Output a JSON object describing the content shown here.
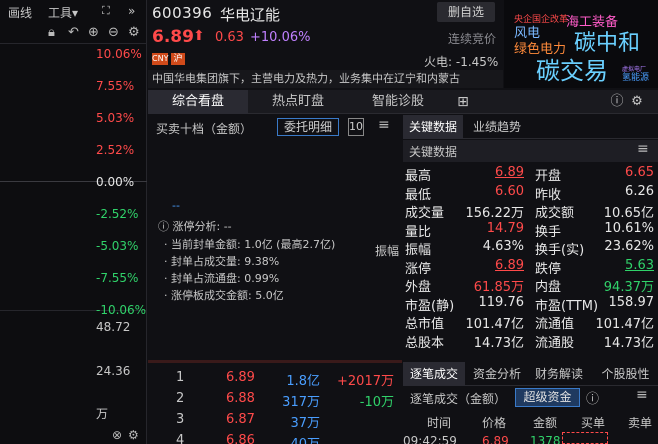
{
  "left_panel": {
    "toolbar": {
      "draw_line": "画线",
      "tools": "工具▾",
      "expand": "»"
    },
    "axis_labels": [
      {
        "text": "10.06%",
        "color": "#ff4a4a"
      },
      {
        "text": "7.55%",
        "color": "#ff4a4a"
      },
      {
        "text": "5.03%",
        "color": "#ff4a4a"
      },
      {
        "text": "2.52%",
        "color": "#ff4a4a"
      },
      {
        "text": "0.00%",
        "color": "#e8e8e8"
      },
      {
        "text": "-2.52%",
        "color": "#30d26a"
      },
      {
        "text": "-5.03%",
        "color": "#30d26a"
      },
      {
        "text": "-7.55%",
        "color": "#30d26a"
      },
      {
        "text": "-10.06%",
        "color": "#30d26a"
      }
    ],
    "volume_labels": [
      "48.72",
      "24.36",
      "万"
    ]
  },
  "header": {
    "code": "600396",
    "name": "华电辽能",
    "fav_button": "删自选",
    "price": "6.89",
    "arrow": "⬆",
    "change": "0.63",
    "change_pct": "+10.06%",
    "status": "连续竞价",
    "badge_cny": "CNY",
    "badge_market": "沪",
    "sector": "火电: -1.45%",
    "description": "中国华电集团旗下，主营电力及热力，业务集中在辽宁和内蒙古"
  },
  "word_cloud": [
    {
      "text": "央企国企改革",
      "color": "#ff4a4a"
    },
    {
      "text": "海工装备",
      "color": "#ff5cc8"
    },
    {
      "text": "风电",
      "color": "#7ab8ff"
    },
    {
      "text": "碳中和",
      "color": "#6ad0ff"
    },
    {
      "text": "绿色电力",
      "color": "#ff8a3a"
    },
    {
      "text": "碳交易",
      "color": "#6ad0ff"
    },
    {
      "text": "虚拟电厂",
      "color": "#b080ff"
    },
    {
      "text": "氢能源",
      "color": "#4a9eff"
    }
  ],
  "tabs": [
    "综合看盘",
    "热点盯盘",
    "智能诊股"
  ],
  "order_panel": {
    "title": "买卖十档（金额）",
    "entrust_button": "委托明细",
    "num_button": "10",
    "dash": "--",
    "analysis_title": "涨停分析:  --",
    "lines": [
      "· 当前封单金额: 1.0亿 (最高2.7亿)",
      "· 封单占成交量: 9.38%",
      "· 封单占流通盘: 0.99%",
      "· 涨停板成交金额: 5.0亿"
    ],
    "side_label": "振幅"
  },
  "key_data": {
    "tab_key": "关键数据",
    "tab_trend": "业绩趋势",
    "sub_title": "关键数据",
    "rows": [
      {
        "l1": "最高",
        "v1": "6.89",
        "c1": "#ff4a4a",
        "u1": true,
        "l2": "开盘",
        "v2": "6.65",
        "c2": "#ff4a4a"
      },
      {
        "l1": "最低",
        "v1": "6.60",
        "c1": "#ff4a4a",
        "l2": "昨收",
        "v2": "6.26",
        "c2": "#e8e8e8"
      },
      {
        "l1": "成交量",
        "v1": "156.22万",
        "c1": "#e8e8e8",
        "l2": "成交额",
        "v2": "10.65亿",
        "c2": "#e8e8e8"
      },
      {
        "l1": "量比",
        "v1": "14.79",
        "c1": "#ff4a4a",
        "l2": "换手",
        "v2": "10.61%",
        "c2": "#e8e8e8"
      },
      {
        "l1": "振幅",
        "v1": "4.63%",
        "c1": "#e8e8e8",
        "l2": "换手(实)",
        "v2": "23.62%",
        "c2": "#e8e8e8"
      },
      {
        "l1": "涨停",
        "v1": "6.89",
        "c1": "#ff4a4a",
        "u1": true,
        "l2": "跌停",
        "v2": "5.63",
        "c2": "#30d26a",
        "u2": true
      },
      {
        "l1": "外盘",
        "v1": "61.85万",
        "c1": "#ff4a4a",
        "l2": "内盘",
        "v2": "94.37万",
        "c2": "#30d26a"
      },
      {
        "l1": "市盈(静)",
        "v1": "119.76",
        "c1": "#e8e8e8",
        "l2": "市盈(TTM)",
        "v2": "158.97",
        "c2": "#e8e8e8"
      },
      {
        "l1": "总市值",
        "v1": "101.47亿",
        "c1": "#e8e8e8",
        "l2": "流通值",
        "v2": "101.47亿",
        "c2": "#e8e8e8"
      },
      {
        "l1": "总股本",
        "v1": "14.73亿",
        "c1": "#e8e8e8",
        "l2": "流通股",
        "v2": "14.73亿",
        "c2": "#e8e8e8"
      }
    ]
  },
  "top_buyers": [
    {
      "rank": "1",
      "price": "6.89",
      "amount": "1.8亿",
      "delta": "+2017万",
      "dcolor": "#ff4a4a"
    },
    {
      "rank": "2",
      "price": "6.88",
      "amount": "317万",
      "delta": "-10万",
      "dcolor": "#30d26a"
    },
    {
      "rank": "3",
      "price": "6.87",
      "amount": "37万",
      "delta": "",
      "dcolor": "#e8e8e8"
    },
    {
      "rank": "4",
      "price": "6.86",
      "amount": "40万",
      "delta": "",
      "dcolor": "#e8e8e8"
    }
  ],
  "trade_panel": {
    "tabs": [
      "逐笔成交",
      "资金分析",
      "财务解读",
      "个股股性"
    ],
    "title": "逐笔成交（金额）",
    "superfund_button": "超级资金",
    "headers": [
      "时间",
      "价格",
      "金额",
      "买单",
      "卖单"
    ],
    "partial_row": {
      "time": "09:42:59",
      "price": "6.89",
      "amount": "1378"
    }
  }
}
